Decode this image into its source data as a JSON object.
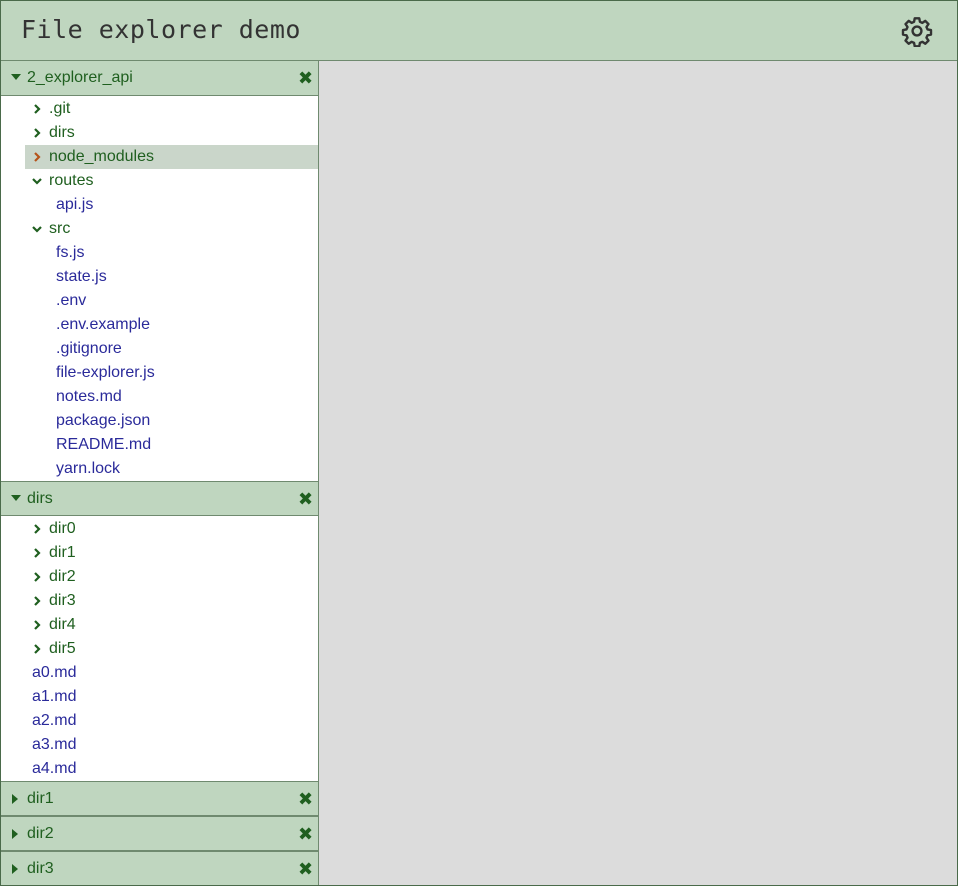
{
  "header": {
    "title": "File explorer demo",
    "settings_icon": "gear-icon"
  },
  "colors": {
    "header_bg": "#bfd6bf",
    "dir_text": "#1f5f1f",
    "file_text": "#2a2a9a",
    "main_bg": "#dcdcdc",
    "highlight_bg": "#cad6ca",
    "chevron_active": "#b5541b"
  },
  "panels": [
    {
      "label": "2_explorer_api",
      "expanded": true,
      "close": "✖",
      "items": [
        {
          "name": ".git",
          "type": "dir",
          "expanded": false
        },
        {
          "name": "dirs",
          "type": "dir",
          "expanded": false
        },
        {
          "name": "node_modules",
          "type": "dir",
          "expanded": false,
          "highlighted": true
        },
        {
          "name": "routes",
          "type": "dir",
          "expanded": true
        },
        {
          "name": "api.js",
          "type": "file"
        },
        {
          "name": "src",
          "type": "dir",
          "expanded": true
        },
        {
          "name": "fs.js",
          "type": "file"
        },
        {
          "name": "state.js",
          "type": "file"
        },
        {
          "name": ".env",
          "type": "file"
        },
        {
          "name": ".env.example",
          "type": "file"
        },
        {
          "name": ".gitignore",
          "type": "file"
        },
        {
          "name": "file-explorer.js",
          "type": "file"
        },
        {
          "name": "notes.md",
          "type": "file"
        },
        {
          "name": "package.json",
          "type": "file"
        },
        {
          "name": "README.md",
          "type": "file"
        },
        {
          "name": "yarn.lock",
          "type": "file"
        }
      ]
    },
    {
      "label": "dirs",
      "expanded": true,
      "close": "✖",
      "items": [
        {
          "name": "dir0",
          "type": "dir",
          "expanded": false
        },
        {
          "name": "dir1",
          "type": "dir",
          "expanded": false
        },
        {
          "name": "dir2",
          "type": "dir",
          "expanded": false
        },
        {
          "name": "dir3",
          "type": "dir",
          "expanded": false
        },
        {
          "name": "dir4",
          "type": "dir",
          "expanded": false
        },
        {
          "name": "dir5",
          "type": "dir",
          "expanded": false
        },
        {
          "name": "a0.md",
          "type": "file"
        },
        {
          "name": "a1.md",
          "type": "file"
        },
        {
          "name": "a2.md",
          "type": "file"
        },
        {
          "name": "a3.md",
          "type": "file"
        },
        {
          "name": "a4.md",
          "type": "file"
        }
      ]
    },
    {
      "label": "dir1",
      "expanded": false,
      "close": "✖",
      "items": []
    },
    {
      "label": "dir2",
      "expanded": false,
      "close": "✖",
      "items": []
    },
    {
      "label": "dir3",
      "expanded": false,
      "close": "✖",
      "items": []
    }
  ]
}
